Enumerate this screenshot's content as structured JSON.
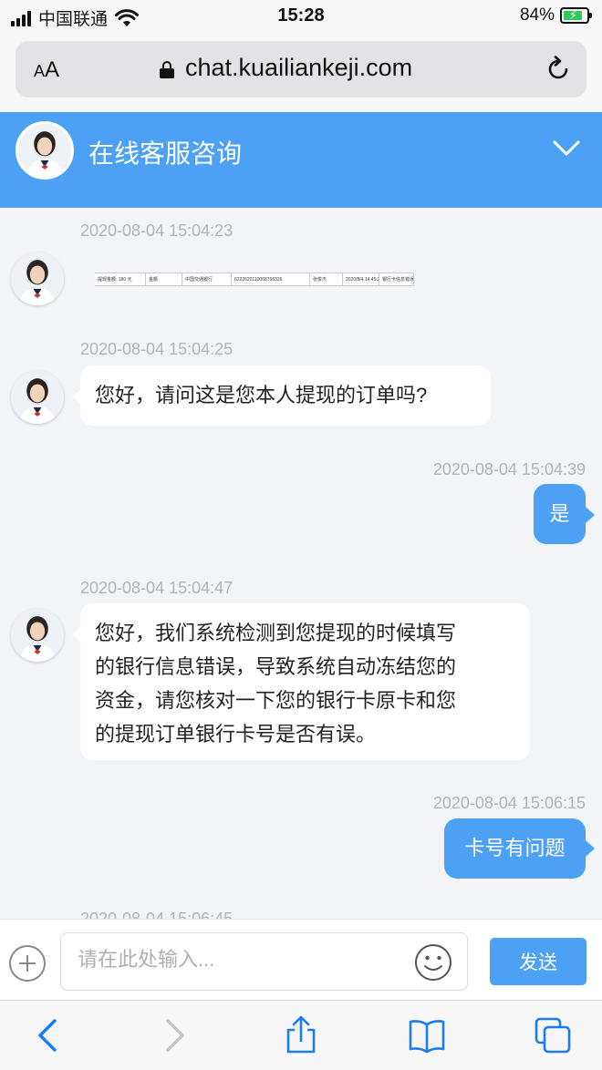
{
  "status_bar": {
    "carrier": "中国联通",
    "time": "15:28",
    "battery_percent": "84%",
    "battery_level": 0.84
  },
  "browser": {
    "text_size_label": "AA",
    "url": "chat.kuailiankeji.com"
  },
  "chat_header": {
    "title": "在线客服咨询"
  },
  "messages": [
    {
      "side": "in",
      "timestamp": "2020-08-04 15:04:23",
      "type": "image",
      "image_cells": [
        "提现金额: 180 元",
        "金额",
        "中国交通银行",
        "6222620110068766326",
        "张俊杰",
        "2020/8/4 14:45:30",
        "银行卡信息错误"
      ]
    },
    {
      "side": "in",
      "timestamp": "2020-08-04 15:04:25",
      "text": "您好，请问这是您本人提现的订单吗?"
    },
    {
      "side": "out",
      "timestamp": "2020-08-04 15:04:39",
      "text": "是"
    },
    {
      "side": "in",
      "timestamp": "2020-08-04 15:04:47",
      "lines": [
        "您好，我们系统检测到您提现的时候填写",
        "的银行信息错误，导致系统自动冻结您的",
        "资金，请您核对一下您的银行卡原卡和您",
        "的提现订单银行卡号是否有误。"
      ]
    },
    {
      "side": "out",
      "timestamp": "2020-08-04 15:06:15",
      "text": "卡号有问题"
    },
    {
      "side": "in",
      "timestamp": "2020-08-04 15:06:45"
    }
  ],
  "composer": {
    "placeholder": "请在此处输入...",
    "send_label": "发送"
  },
  "colors": {
    "accent": "#4da1f5",
    "background": "#f2f4f8",
    "timestamp": "#b0b4ba",
    "battery": "#34c759"
  },
  "icons": {
    "wifi": "wifi-icon",
    "lock": "lock-icon",
    "reload": "reload-icon",
    "collapse": "chevron-down-icon",
    "add": "plus-circle-icon",
    "emoji": "smiley-icon",
    "back": "chevron-left-icon",
    "forward": "chevron-right-icon",
    "share": "share-icon",
    "bookmarks": "book-icon",
    "tabs": "tabs-icon"
  }
}
